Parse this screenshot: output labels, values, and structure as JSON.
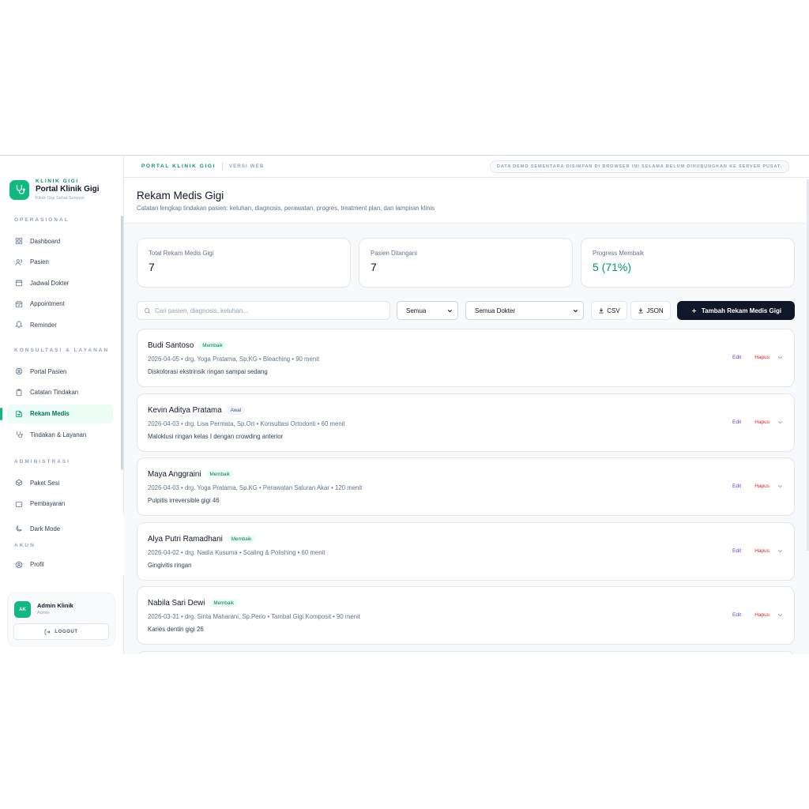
{
  "brand": {
    "kicker": "KLINIK GIGI",
    "title": "Portal Klinik Gigi",
    "subtitle": "Klinik Gigi Sehat Senyum"
  },
  "sidebar": {
    "sections": [
      {
        "label": "OPERASIONAL",
        "items": [
          {
            "label": "Dashboard",
            "icon": "grid-icon"
          },
          {
            "label": "Pasien",
            "icon": "users-icon"
          },
          {
            "label": "Jadwal Dokter",
            "icon": "calendar-icon"
          },
          {
            "label": "Appointment",
            "icon": "calendar-check-icon"
          },
          {
            "label": "Reminder",
            "icon": "bell-icon"
          }
        ]
      },
      {
        "label": "KONSULTASI & LAYANAN",
        "items": [
          {
            "label": "Portal Pasien",
            "icon": "user-circle-icon"
          },
          {
            "label": "Catatan Tindakan",
            "icon": "clipboard-icon"
          },
          {
            "label": "Rekam Medis",
            "icon": "file-text-icon",
            "active": true
          },
          {
            "label": "Tindakan & Layanan",
            "icon": "stethoscope-icon"
          }
        ]
      },
      {
        "label": "ADMINISTRASI",
        "items": [
          {
            "label": "Paket Sesi",
            "icon": "package-icon"
          },
          {
            "label": "Pembayaran",
            "icon": "wallet-icon"
          }
        ]
      }
    ],
    "dark_mode": "Dark Mode",
    "account_label": "AKUN",
    "profile": "Profil",
    "user": {
      "initials": "AK",
      "name": "Admin Klinik",
      "role": "Admin"
    },
    "logout": "LOGOUT"
  },
  "topbar": {
    "brand": "PORTAL KLINIK GIGI",
    "version": "VERSI WEB",
    "notice": "DATA DEMO SEMENTARA DISIMPAN DI BROWSER INI SELAMA BELUM DIHUBUNGKAN KE SERVER PUSAT."
  },
  "page": {
    "title": "Rekam Medis Gigi",
    "subtitle": "Catatan lengkap tindakan pasien: keluhan, diagnosis, perawatan, progres, treatment plan, dan lampiran klinis"
  },
  "stats": [
    {
      "label": "Total Rekam Medis Gigi",
      "value": "7"
    },
    {
      "label": "Pasien Ditangani",
      "value": "7"
    },
    {
      "label": "Progress Membaik",
      "value": "5 (71%)"
    }
  ],
  "toolbar": {
    "search_placeholder": "Cari pasien, diagnosis, keluhan...",
    "status_filter": "Semua",
    "doctor_filter": "Semua Dokter",
    "csv": "CSV",
    "json": "JSON",
    "add": "Tambah Rekam Medis Gigi"
  },
  "records": [
    {
      "name": "Budi Santoso",
      "badge": "Membaik",
      "meta": "2026-04-05 • drg. Yoga Pratama, Sp.KG • Bleaching • 90 menit",
      "desc": "Diskolorasi ekstrinsik ringan sampai sedang"
    },
    {
      "name": "Kevin Aditya Pratama",
      "badge": "Awal",
      "meta": "2026-04-03 • drg. Lisa Permata, Sp.Ort • Konsultasi Ortodonti • 60 menit",
      "desc": "Maloklusi ringan kelas I dengan crowding anterior"
    },
    {
      "name": "Maya Anggraini",
      "badge": "Membaik",
      "meta": "2026-04-03 • drg. Yoga Pratama, Sp.KG • Perawatan Saluran Akar • 120 menit",
      "desc": "Pulpitis irreversible gigi 46"
    },
    {
      "name": "Alya Putri Ramadhani",
      "badge": "Membaik",
      "meta": "2026-04-02 • drg. Nadia Kusuma • Scaling & Polishing • 60 menit",
      "desc": "Gingivitis ringan"
    },
    {
      "name": "Nabila Sari Dewi",
      "badge": "Membaik",
      "meta": "2026-03-31 • drg. Sinta Maharani, Sp.Perio • Tambal Gigi Komposit • 90 menit",
      "desc": "Karies dentin gigi 26"
    }
  ],
  "record_actions": {
    "edit": "Edit",
    "delete": "Hapus"
  },
  "colors": {
    "accent": "#10b981",
    "dark": "#0f172a",
    "danger": "#dc2626",
    "link": "#4f46e5"
  }
}
